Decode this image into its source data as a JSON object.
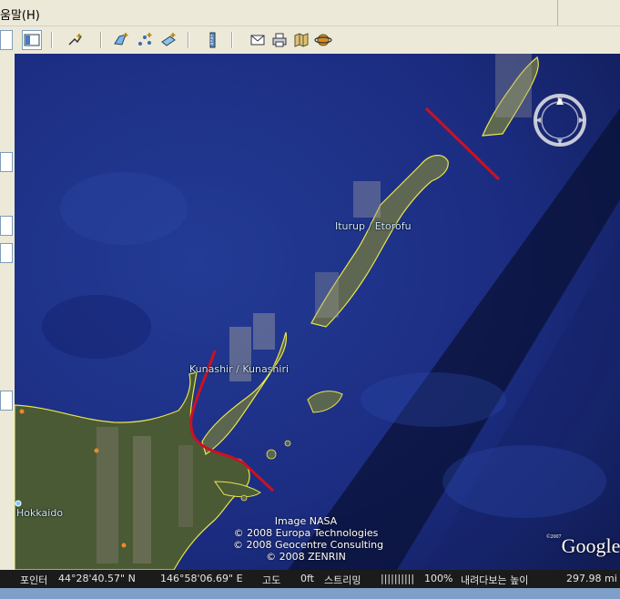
{
  "menubar": {
    "help_label": "움말(H)"
  },
  "map": {
    "labels": {
      "iturup": "Iturup / Etorofu",
      "kunashir": "Kunashir / Kunashiri",
      "hokkaido": "Hokkaido"
    },
    "credits": {
      "line1": "Image NASA",
      "line2": "© 2008 Europa Technologies",
      "line3": "© 2008 Geocentre Consulting",
      "line4": "© 2008 ZENRIN"
    },
    "logo": {
      "text": "Google",
      "copyright_small": "©2007"
    },
    "compass_north": "N"
  },
  "statusbar": {
    "pointer_label": "포인터",
    "latitude": "44°28'40.57\" N",
    "longitude": "146°58'06.69\" E",
    "altitude_label": "고도",
    "altitude_value": "0ft",
    "streaming_label": "스트리밍",
    "streaming_bar": "||||||||||",
    "streaming_percent": "100%",
    "eye_alt_label": "내려다보는 높이",
    "eye_alt_value": "297.98 mi"
  },
  "colors": {
    "ocean": "#1e2f86",
    "coast": "#e8e64a",
    "border_line": "#cc1122"
  }
}
